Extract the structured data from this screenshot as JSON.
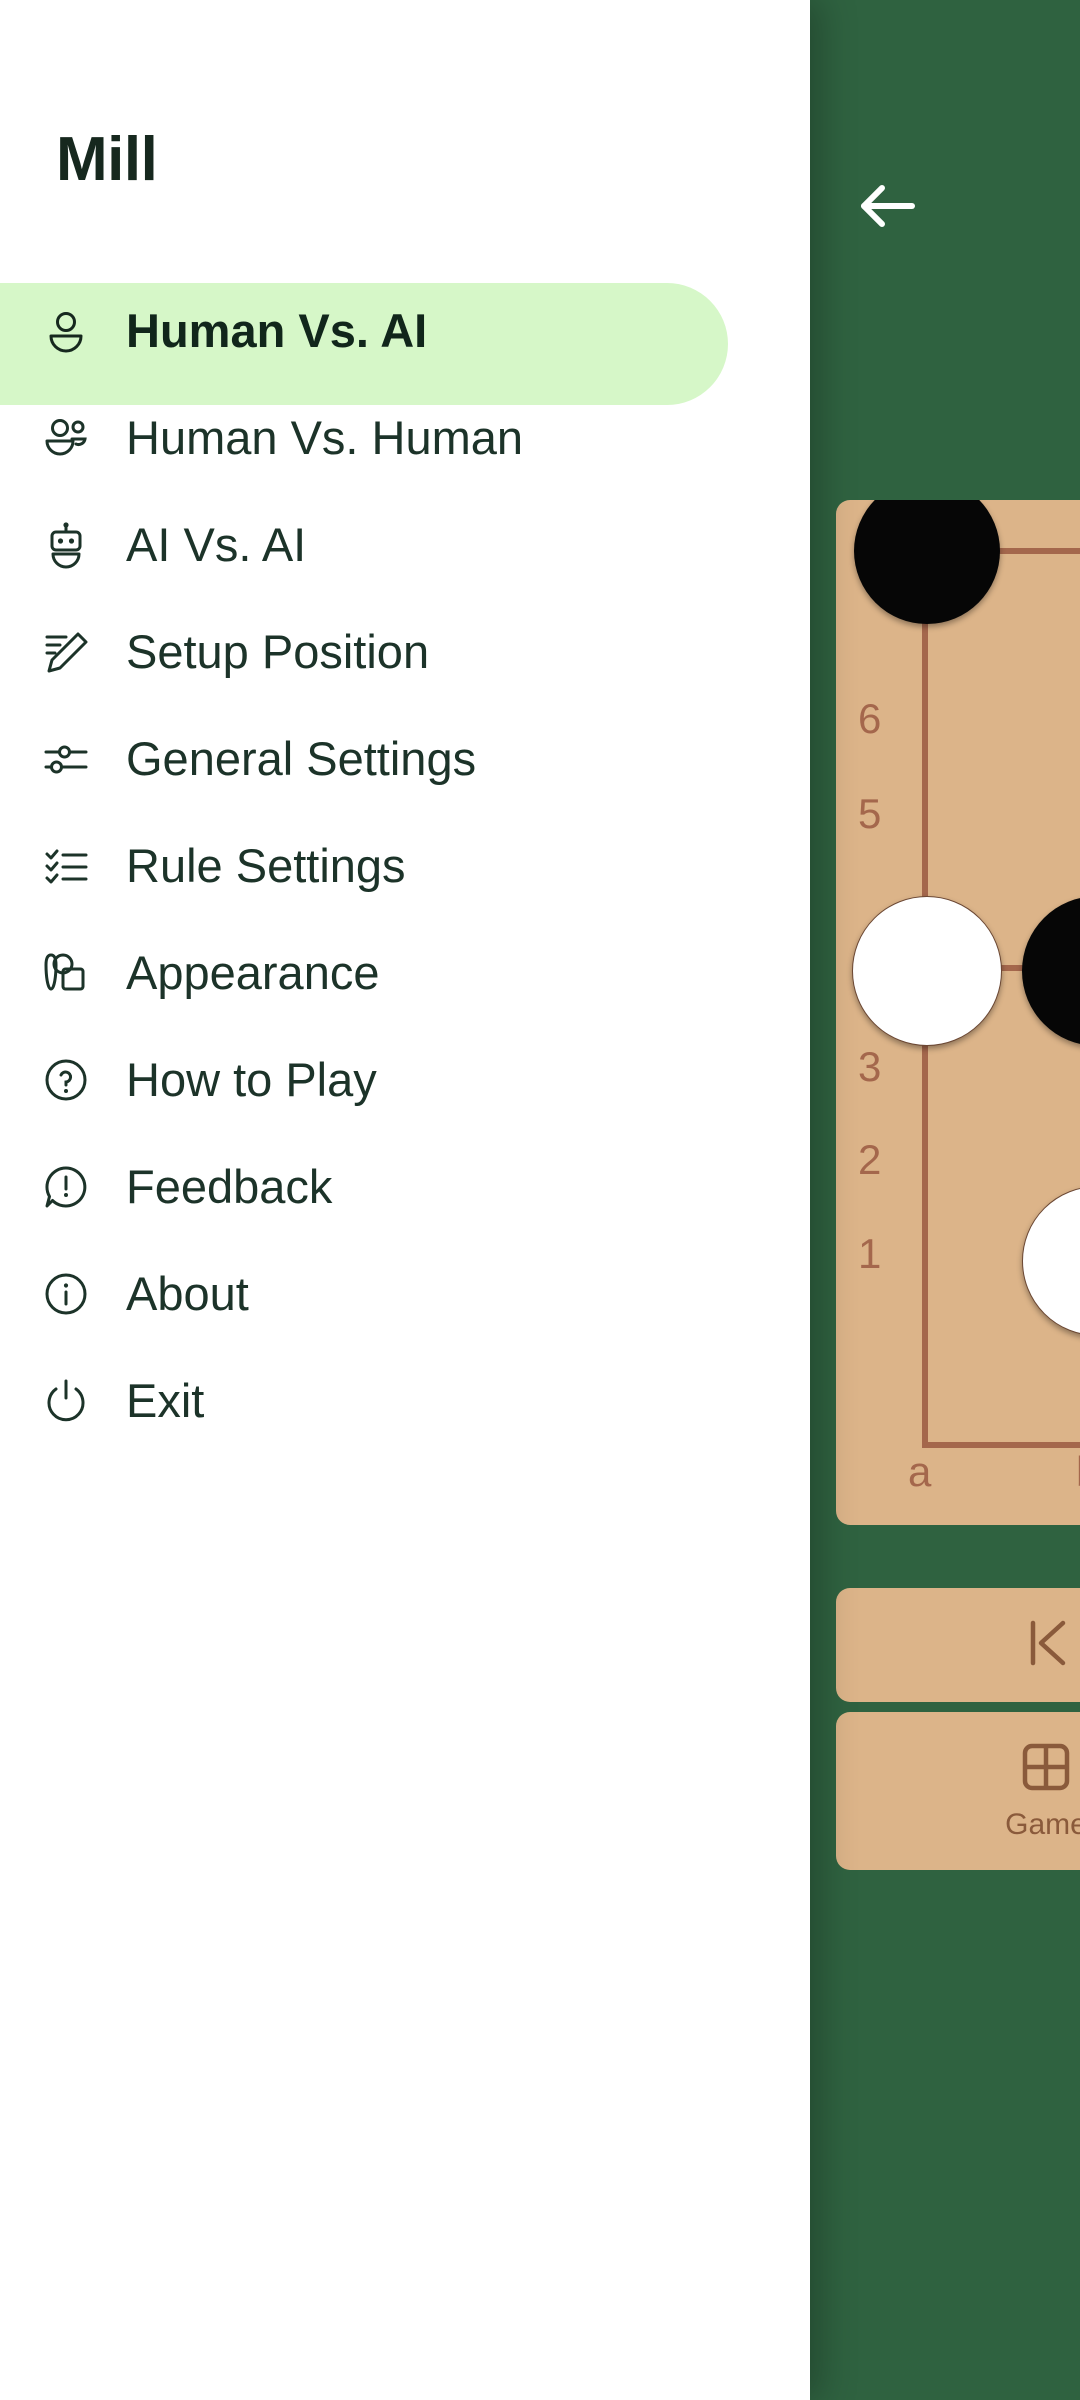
{
  "app": {
    "drawer_title": "Mill",
    "accent_selected_bg": "#D6F7C8",
    "panel_green": "#2F6240",
    "board_tan": "#DCB489",
    "board_line": "#A4674C"
  },
  "sidebar": {
    "items": [
      {
        "label": "Human Vs. AI",
        "icon": "person-icon",
        "selected": true
      },
      {
        "label": "Human Vs. Human",
        "icon": "people-icon",
        "selected": false
      },
      {
        "label": "AI Vs. AI",
        "icon": "robot-icon",
        "selected": false
      },
      {
        "label": "Setup Position",
        "icon": "pencil-edit-icon",
        "selected": false
      },
      {
        "label": "General Settings",
        "icon": "sliders-icon",
        "selected": false
      },
      {
        "label": "Rule Settings",
        "icon": "checklist-icon",
        "selected": false
      },
      {
        "label": "Appearance",
        "icon": "palette-brush-icon",
        "selected": false
      },
      {
        "label": "How to Play",
        "icon": "question-circle-icon",
        "selected": false
      },
      {
        "label": "Feedback",
        "icon": "feedback-bubble-icon",
        "selected": false
      },
      {
        "label": "About",
        "icon": "info-circle-icon",
        "selected": false
      },
      {
        "label": "Exit",
        "icon": "power-icon",
        "selected": false
      }
    ]
  },
  "game": {
    "back_icon": "arrow-left-icon",
    "board": {
      "file_labels": [
        "a",
        "b"
      ],
      "rank_labels": [
        "6",
        "5",
        "3",
        "2",
        "1"
      ],
      "pieces": [
        {
          "color": "black",
          "file": "a",
          "rank": "7"
        },
        {
          "color": "white",
          "file": "a",
          "rank": "4"
        },
        {
          "color": "black",
          "file": "b",
          "rank": "4"
        },
        {
          "color": "white",
          "file": "b",
          "rank": "2"
        }
      ]
    },
    "toolbar": [
      {
        "icon": "skip-to-first-icon",
        "label": ""
      },
      {
        "icon": "grid-icon",
        "label": "Game"
      }
    ]
  }
}
